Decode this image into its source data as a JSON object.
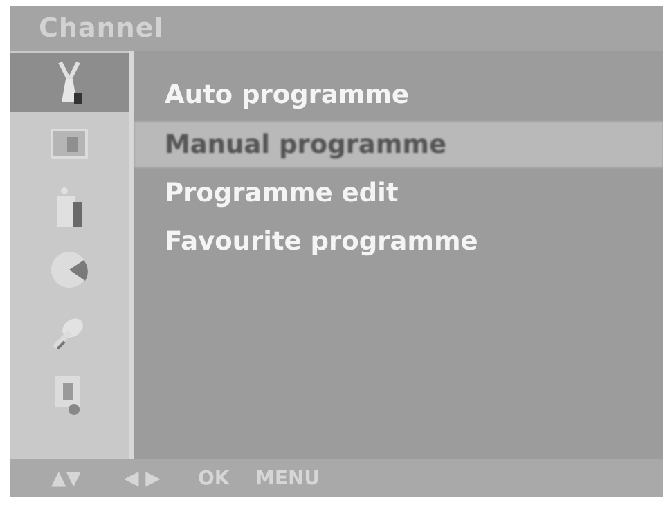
{
  "menu": {
    "title": "Channel",
    "items": [
      {
        "label": "Auto programme"
      },
      {
        "label": "Manual programme",
        "selected": true
      },
      {
        "label": "Programme edit"
      },
      {
        "label": "Favourite programme"
      }
    ]
  },
  "sidebar": {
    "icons": [
      {
        "name": "channel-antenna-icon",
        "active": true
      },
      {
        "name": "picture-icon"
      },
      {
        "name": "sound-icon"
      },
      {
        "name": "time-clock-icon"
      },
      {
        "name": "special-settings-icon"
      },
      {
        "name": "screen-icon"
      }
    ]
  },
  "footer": {
    "updown_glyph": "▲▼",
    "leftright_glyph": "◀ ▶",
    "ok_label": "OK",
    "menu_label": "MENU"
  },
  "colors": {
    "panel_bg": "#9c9c9c",
    "highlight_bg": "#b9b9b9",
    "text": "#f4f4f4"
  }
}
